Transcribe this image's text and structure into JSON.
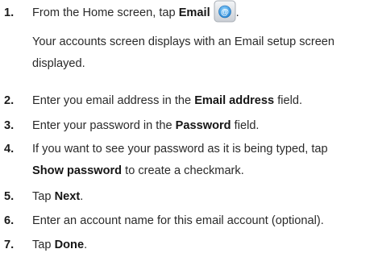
{
  "steps": [
    {
      "number": "1.",
      "before": "From the Home screen, tap ",
      "bold": "Email",
      "icon": "email-app-icon",
      "after": ".",
      "note_line1": "Your accounts screen displays with an Email setup screen",
      "note_line2": "displayed."
    },
    {
      "number": "2.",
      "before": "Enter you email address in the ",
      "bold": "Email address",
      "after": " field."
    },
    {
      "number": "3.",
      "before": "Enter your password in the ",
      "bold": "Password",
      "after": " field."
    },
    {
      "number": "4.",
      "line1": "If you want to see your password as it is being typed, tap",
      "bold": "Show password",
      "after": " to create a checkmark."
    },
    {
      "number": "5.",
      "before": "Tap ",
      "bold": "Next",
      "after": "."
    },
    {
      "number": "6.",
      "text": "Enter an account name for this email account (optional)."
    },
    {
      "number": "7.",
      "before": "Tap ",
      "bold": "Done",
      "after": "."
    }
  ]
}
